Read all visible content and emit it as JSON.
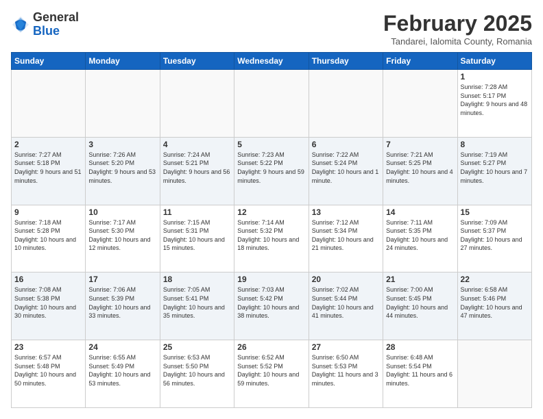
{
  "logo": {
    "general": "General",
    "blue": "Blue"
  },
  "title": "February 2025",
  "location": "Tandarei, Ialomita County, Romania",
  "days_of_week": [
    "Sunday",
    "Monday",
    "Tuesday",
    "Wednesday",
    "Thursday",
    "Friday",
    "Saturday"
  ],
  "weeks": [
    [
      {
        "day": "",
        "info": ""
      },
      {
        "day": "",
        "info": ""
      },
      {
        "day": "",
        "info": ""
      },
      {
        "day": "",
        "info": ""
      },
      {
        "day": "",
        "info": ""
      },
      {
        "day": "",
        "info": ""
      },
      {
        "day": "1",
        "info": "Sunrise: 7:28 AM\nSunset: 5:17 PM\nDaylight: 9 hours and 48 minutes."
      }
    ],
    [
      {
        "day": "2",
        "info": "Sunrise: 7:27 AM\nSunset: 5:18 PM\nDaylight: 9 hours and 51 minutes."
      },
      {
        "day": "3",
        "info": "Sunrise: 7:26 AM\nSunset: 5:20 PM\nDaylight: 9 hours and 53 minutes."
      },
      {
        "day": "4",
        "info": "Sunrise: 7:24 AM\nSunset: 5:21 PM\nDaylight: 9 hours and 56 minutes."
      },
      {
        "day": "5",
        "info": "Sunrise: 7:23 AM\nSunset: 5:22 PM\nDaylight: 9 hours and 59 minutes."
      },
      {
        "day": "6",
        "info": "Sunrise: 7:22 AM\nSunset: 5:24 PM\nDaylight: 10 hours and 1 minute."
      },
      {
        "day": "7",
        "info": "Sunrise: 7:21 AM\nSunset: 5:25 PM\nDaylight: 10 hours and 4 minutes."
      },
      {
        "day": "8",
        "info": "Sunrise: 7:19 AM\nSunset: 5:27 PM\nDaylight: 10 hours and 7 minutes."
      }
    ],
    [
      {
        "day": "9",
        "info": "Sunrise: 7:18 AM\nSunset: 5:28 PM\nDaylight: 10 hours and 10 minutes."
      },
      {
        "day": "10",
        "info": "Sunrise: 7:17 AM\nSunset: 5:30 PM\nDaylight: 10 hours and 12 minutes."
      },
      {
        "day": "11",
        "info": "Sunrise: 7:15 AM\nSunset: 5:31 PM\nDaylight: 10 hours and 15 minutes."
      },
      {
        "day": "12",
        "info": "Sunrise: 7:14 AM\nSunset: 5:32 PM\nDaylight: 10 hours and 18 minutes."
      },
      {
        "day": "13",
        "info": "Sunrise: 7:12 AM\nSunset: 5:34 PM\nDaylight: 10 hours and 21 minutes."
      },
      {
        "day": "14",
        "info": "Sunrise: 7:11 AM\nSunset: 5:35 PM\nDaylight: 10 hours and 24 minutes."
      },
      {
        "day": "15",
        "info": "Sunrise: 7:09 AM\nSunset: 5:37 PM\nDaylight: 10 hours and 27 minutes."
      }
    ],
    [
      {
        "day": "16",
        "info": "Sunrise: 7:08 AM\nSunset: 5:38 PM\nDaylight: 10 hours and 30 minutes."
      },
      {
        "day": "17",
        "info": "Sunrise: 7:06 AM\nSunset: 5:39 PM\nDaylight: 10 hours and 33 minutes."
      },
      {
        "day": "18",
        "info": "Sunrise: 7:05 AM\nSunset: 5:41 PM\nDaylight: 10 hours and 35 minutes."
      },
      {
        "day": "19",
        "info": "Sunrise: 7:03 AM\nSunset: 5:42 PM\nDaylight: 10 hours and 38 minutes."
      },
      {
        "day": "20",
        "info": "Sunrise: 7:02 AM\nSunset: 5:44 PM\nDaylight: 10 hours and 41 minutes."
      },
      {
        "day": "21",
        "info": "Sunrise: 7:00 AM\nSunset: 5:45 PM\nDaylight: 10 hours and 44 minutes."
      },
      {
        "day": "22",
        "info": "Sunrise: 6:58 AM\nSunset: 5:46 PM\nDaylight: 10 hours and 47 minutes."
      }
    ],
    [
      {
        "day": "23",
        "info": "Sunrise: 6:57 AM\nSunset: 5:48 PM\nDaylight: 10 hours and 50 minutes."
      },
      {
        "day": "24",
        "info": "Sunrise: 6:55 AM\nSunset: 5:49 PM\nDaylight: 10 hours and 53 minutes."
      },
      {
        "day": "25",
        "info": "Sunrise: 6:53 AM\nSunset: 5:50 PM\nDaylight: 10 hours and 56 minutes."
      },
      {
        "day": "26",
        "info": "Sunrise: 6:52 AM\nSunset: 5:52 PM\nDaylight: 10 hours and 59 minutes."
      },
      {
        "day": "27",
        "info": "Sunrise: 6:50 AM\nSunset: 5:53 PM\nDaylight: 11 hours and 3 minutes."
      },
      {
        "day": "28",
        "info": "Sunrise: 6:48 AM\nSunset: 5:54 PM\nDaylight: 11 hours and 6 minutes."
      },
      {
        "day": "",
        "info": ""
      }
    ]
  ]
}
